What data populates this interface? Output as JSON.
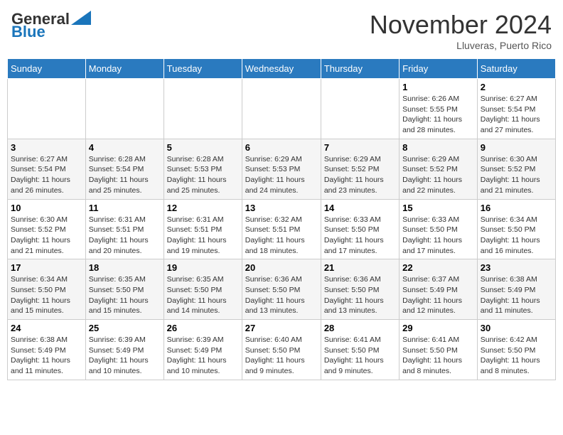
{
  "header": {
    "logo_line1": "General",
    "logo_line2": "Blue",
    "month_title": "November 2024",
    "location": "Lluveras, Puerto Rico"
  },
  "weekdays": [
    "Sunday",
    "Monday",
    "Tuesday",
    "Wednesday",
    "Thursday",
    "Friday",
    "Saturday"
  ],
  "weeks": [
    [
      {
        "day": "",
        "info": ""
      },
      {
        "day": "",
        "info": ""
      },
      {
        "day": "",
        "info": ""
      },
      {
        "day": "",
        "info": ""
      },
      {
        "day": "",
        "info": ""
      },
      {
        "day": "1",
        "info": "Sunrise: 6:26 AM\nSunset: 5:55 PM\nDaylight: 11 hours and 28 minutes."
      },
      {
        "day": "2",
        "info": "Sunrise: 6:27 AM\nSunset: 5:54 PM\nDaylight: 11 hours and 27 minutes."
      }
    ],
    [
      {
        "day": "3",
        "info": "Sunrise: 6:27 AM\nSunset: 5:54 PM\nDaylight: 11 hours and 26 minutes."
      },
      {
        "day": "4",
        "info": "Sunrise: 6:28 AM\nSunset: 5:54 PM\nDaylight: 11 hours and 25 minutes."
      },
      {
        "day": "5",
        "info": "Sunrise: 6:28 AM\nSunset: 5:53 PM\nDaylight: 11 hours and 25 minutes."
      },
      {
        "day": "6",
        "info": "Sunrise: 6:29 AM\nSunset: 5:53 PM\nDaylight: 11 hours and 24 minutes."
      },
      {
        "day": "7",
        "info": "Sunrise: 6:29 AM\nSunset: 5:52 PM\nDaylight: 11 hours and 23 minutes."
      },
      {
        "day": "8",
        "info": "Sunrise: 6:29 AM\nSunset: 5:52 PM\nDaylight: 11 hours and 22 minutes."
      },
      {
        "day": "9",
        "info": "Sunrise: 6:30 AM\nSunset: 5:52 PM\nDaylight: 11 hours and 21 minutes."
      }
    ],
    [
      {
        "day": "10",
        "info": "Sunrise: 6:30 AM\nSunset: 5:52 PM\nDaylight: 11 hours and 21 minutes."
      },
      {
        "day": "11",
        "info": "Sunrise: 6:31 AM\nSunset: 5:51 PM\nDaylight: 11 hours and 20 minutes."
      },
      {
        "day": "12",
        "info": "Sunrise: 6:31 AM\nSunset: 5:51 PM\nDaylight: 11 hours and 19 minutes."
      },
      {
        "day": "13",
        "info": "Sunrise: 6:32 AM\nSunset: 5:51 PM\nDaylight: 11 hours and 18 minutes."
      },
      {
        "day": "14",
        "info": "Sunrise: 6:33 AM\nSunset: 5:50 PM\nDaylight: 11 hours and 17 minutes."
      },
      {
        "day": "15",
        "info": "Sunrise: 6:33 AM\nSunset: 5:50 PM\nDaylight: 11 hours and 17 minutes."
      },
      {
        "day": "16",
        "info": "Sunrise: 6:34 AM\nSunset: 5:50 PM\nDaylight: 11 hours and 16 minutes."
      }
    ],
    [
      {
        "day": "17",
        "info": "Sunrise: 6:34 AM\nSunset: 5:50 PM\nDaylight: 11 hours and 15 minutes."
      },
      {
        "day": "18",
        "info": "Sunrise: 6:35 AM\nSunset: 5:50 PM\nDaylight: 11 hours and 15 minutes."
      },
      {
        "day": "19",
        "info": "Sunrise: 6:35 AM\nSunset: 5:50 PM\nDaylight: 11 hours and 14 minutes."
      },
      {
        "day": "20",
        "info": "Sunrise: 6:36 AM\nSunset: 5:50 PM\nDaylight: 11 hours and 13 minutes."
      },
      {
        "day": "21",
        "info": "Sunrise: 6:36 AM\nSunset: 5:50 PM\nDaylight: 11 hours and 13 minutes."
      },
      {
        "day": "22",
        "info": "Sunrise: 6:37 AM\nSunset: 5:49 PM\nDaylight: 11 hours and 12 minutes."
      },
      {
        "day": "23",
        "info": "Sunrise: 6:38 AM\nSunset: 5:49 PM\nDaylight: 11 hours and 11 minutes."
      }
    ],
    [
      {
        "day": "24",
        "info": "Sunrise: 6:38 AM\nSunset: 5:49 PM\nDaylight: 11 hours and 11 minutes."
      },
      {
        "day": "25",
        "info": "Sunrise: 6:39 AM\nSunset: 5:49 PM\nDaylight: 11 hours and 10 minutes."
      },
      {
        "day": "26",
        "info": "Sunrise: 6:39 AM\nSunset: 5:49 PM\nDaylight: 11 hours and 10 minutes."
      },
      {
        "day": "27",
        "info": "Sunrise: 6:40 AM\nSunset: 5:50 PM\nDaylight: 11 hours and 9 minutes."
      },
      {
        "day": "28",
        "info": "Sunrise: 6:41 AM\nSunset: 5:50 PM\nDaylight: 11 hours and 9 minutes."
      },
      {
        "day": "29",
        "info": "Sunrise: 6:41 AM\nSunset: 5:50 PM\nDaylight: 11 hours and 8 minutes."
      },
      {
        "day": "30",
        "info": "Sunrise: 6:42 AM\nSunset: 5:50 PM\nDaylight: 11 hours and 8 minutes."
      }
    ]
  ]
}
